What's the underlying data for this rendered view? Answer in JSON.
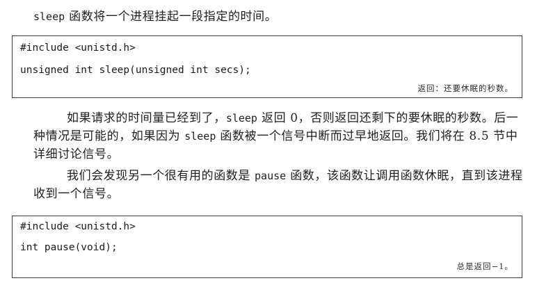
{
  "intro": {
    "code": "sleep",
    "text": "函数将一个进程挂起一段指定的时间。"
  },
  "box1": {
    "line1": "#include <unistd.h>",
    "line2": "unsigned int sleep(unsigned int secs);",
    "note": "返回：还要休眠的秒数。"
  },
  "para1": {
    "l1_a": "如果请求的时间量已经到了，",
    "l1_code1": "sleep",
    "l1_b": "返回 0，否则返回还剩下的要休眠的秒数。后一",
    "l2_a": "种情况是可能的，如果因为",
    "l2_code": "sleep",
    "l2_b": "函数被一个信号中断而过早地返回。我们将在 8.5 节中",
    "l3": "详细讨论信号。"
  },
  "para2": {
    "l1_a": "我们会发现另一个很有用的函数是",
    "l1_code": "pause",
    "l1_b": "函数，该函数让调用函数休眠，直到该进程",
    "l2": "收到一个信号。"
  },
  "box2": {
    "line1": "#include <unistd.h>",
    "line2": "int pause(void);",
    "note": "总是返回−1。"
  }
}
